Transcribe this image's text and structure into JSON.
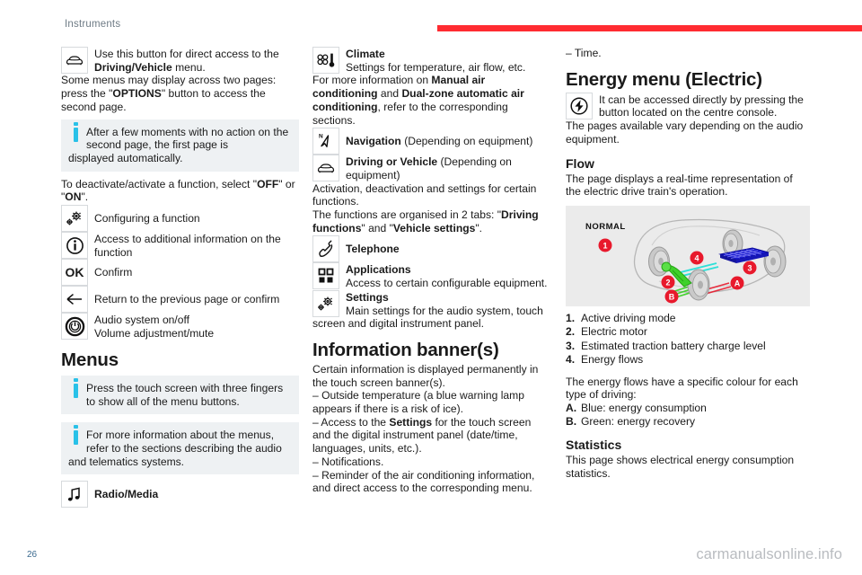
{
  "header": {
    "title": "Instruments",
    "accent_color": "#ff2b31"
  },
  "footer": {
    "page_number": "26",
    "watermark": "carmanualsonline.info"
  },
  "column_1": {
    "vehicle_button": {
      "icon": "car-front-icon",
      "text_part1": "Use this button for direct access to the ",
      "text_bold": "Driving/Vehicle",
      "text_part2": " menu."
    },
    "para_two_pages_1": "Some menus may display across two pages: press the \"",
    "para_two_pages_bold": "OPTIONS",
    "para_two_pages_2": "\" button to access the second page.",
    "note_1": {
      "icon": "info-icon",
      "text": "After a few moments with no action on the second page, the first page is",
      "text_after": "displayed automatically."
    },
    "para_deactivate_1": "To deactivate/activate a function, select \"",
    "para_deactivate_off": "OFF",
    "para_deactivate_2": "\" or \"",
    "para_deactivate_on": "ON",
    "para_deactivate_3": "\".",
    "rows": [
      {
        "icon": "gear-config-icon",
        "label": "Configuring a function"
      },
      {
        "icon": "info-circle-icon",
        "label": "Access to additional information on the function"
      },
      {
        "icon": "ok-icon",
        "label": "Confirm"
      },
      {
        "icon": "arrow-left-icon",
        "label": "Return to the previous page or confirm"
      },
      {
        "icon": "power-icon",
        "label_line1": "Audio system on/off",
        "label_line2": "Volume adjustment/mute"
      }
    ],
    "menus_heading": "Menus",
    "note_2": {
      "icon": "info-icon",
      "text": "Press the touch screen with three fingers to show all of the menu buttons."
    },
    "note_3": {
      "icon": "info-icon",
      "text": "For more information about the menus, refer to the sections describing the audio",
      "text_after": "and telematics systems."
    },
    "radio_media": {
      "icon": "music-note-icon",
      "label": "Radio/Media"
    }
  },
  "column_2": {
    "climate": {
      "icon": "fan-thermometer-icon",
      "title": "Climate",
      "desc": "Settings for temperature, air flow, etc."
    },
    "climate_para_1": "For more information on ",
    "climate_para_bold_1": "Manual air conditioning",
    "climate_para_2": " and ",
    "climate_para_bold_2": "Dual-zone automatic air conditioning",
    "climate_para_3": ", refer to the corresponding sections.",
    "navigation": {
      "icon": "compass-north-icon",
      "title": "Navigation",
      "suffix": " (Depending on equipment)"
    },
    "driving_vehicle": {
      "icon": "car-front-icon",
      "title": "Driving or Vehicle",
      "suffix": " (Depending on equipment)"
    },
    "driving_para_1": "Activation, deactivation and settings for certain functions.",
    "driving_para_2a": "The functions are organised in 2 tabs: \"",
    "driving_para_bold_1": "Driving functions",
    "driving_para_2b": "\" and \"",
    "driving_para_bold_2": "Vehicle settings",
    "driving_para_2c": "\".",
    "telephone": {
      "icon": "telephone-icon",
      "title": "Telephone"
    },
    "applications": {
      "icon": "apps-grid-icon",
      "title": "Applications",
      "desc": "Access to certain configurable equipment."
    },
    "settings": {
      "icon": "gear-config-icon",
      "title": "Settings",
      "desc": "Main settings for the audio system, touch"
    },
    "settings_desc_cont": "screen and digital instrument panel.",
    "banner_heading": "Information banner(s)",
    "banner_intro": "Certain information is displayed permanently in the touch screen banner(s).",
    "banner_items": [
      "–  Outside temperature (a blue warning lamp appears if there is a risk of ice).",
      "–  Notifications.",
      "–  Reminder of the air conditioning information, and direct access to the corresponding menu."
    ],
    "banner_settings_1": "–  Access to the ",
    "banner_settings_bold": "Settings",
    "banner_settings_2": " for the touch screen and the digital instrument panel (date/time, languages, units, etc.)."
  },
  "column_3": {
    "time_item": "–  Time.",
    "energy_heading": "Energy menu (Electric)",
    "energy_button": {
      "icon": "energy-bolt-icon",
      "text": "It can be accessed directly by pressing the button located on the centre console."
    },
    "energy_para": "The pages available vary depending on the audio equipment.",
    "flow_heading": "Flow",
    "flow_para": "The page displays a real-time representation of the electric drive train's operation.",
    "figure": {
      "name": "energy-flow-diagram",
      "mode_label": "NORMAL",
      "callouts": [
        "1",
        "2",
        "3",
        "4"
      ],
      "letter_callouts": [
        "A",
        "B"
      ],
      "callout_color": "#e8192c",
      "battery_color": "#1b1bd1",
      "motor_color": "#3fd12a",
      "consumption_flow_color": "#e8192c",
      "recovery_flow_color": "#3fd12a"
    },
    "legend": [
      {
        "n": "1.",
        "label": "Active driving mode"
      },
      {
        "n": "2.",
        "label": "Electric motor"
      },
      {
        "n": "3.",
        "label": "Estimated traction battery charge level"
      },
      {
        "n": "4.",
        "label": "Energy flows"
      }
    ],
    "flows_intro": "The energy flows have a specific colour for each type of driving:",
    "flow_colours": [
      {
        "n": "A.",
        "label": "Blue: energy consumption"
      },
      {
        "n": "B.",
        "label": "Green: energy recovery"
      }
    ],
    "statistics_heading": "Statistics",
    "statistics_para": "This page shows electrical energy consumption statistics."
  }
}
